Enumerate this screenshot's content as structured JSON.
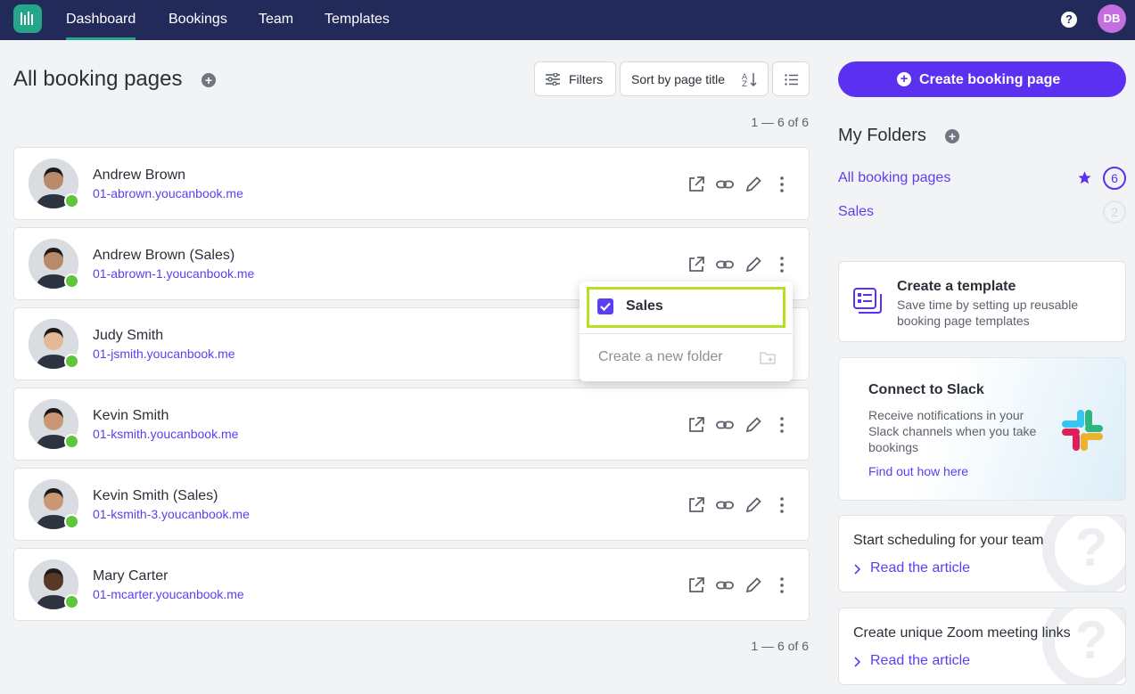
{
  "nav": {
    "items": [
      "Dashboard",
      "Bookings",
      "Team",
      "Templates"
    ],
    "active": "Dashboard",
    "help": "?",
    "user_initials": "DB"
  },
  "header": {
    "title": "All booking pages",
    "filters_label": "Filters",
    "sort_label": "Sort by page title",
    "count_top": "1 — 6 of 6",
    "count_bottom": "1 — 6 of 6"
  },
  "bookings": [
    {
      "name": "Andrew Brown",
      "link": "01-abrown.youcanbook.me",
      "status": "online"
    },
    {
      "name": "Andrew Brown (Sales)",
      "link": "01-abrown-1.youcanbook.me",
      "status": "online"
    },
    {
      "name": "Judy Smith",
      "link": "01-jsmith.youcanbook.me",
      "status": "online"
    },
    {
      "name": "Kevin Smith",
      "link": "01-ksmith.youcanbook.me",
      "status": "online"
    },
    {
      "name": "Kevin Smith (Sales)",
      "link": "01-ksmith-3.youcanbook.me",
      "status": "online"
    },
    {
      "name": "Mary Carter",
      "link": "01-mcarter.youcanbook.me",
      "status": "online"
    }
  ],
  "dropdown": {
    "folder": "Sales",
    "checked": true,
    "create_label": "Create a new folder"
  },
  "sidebar": {
    "create_button": "Create booking page",
    "folders_title": "My Folders",
    "folders": [
      {
        "label": "All booking pages",
        "count": "6",
        "starred": true
      },
      {
        "label": "Sales",
        "count": "2",
        "starred": false
      }
    ],
    "template_card": {
      "title": "Create a template",
      "text": "Save time by setting up reusable booking page templates"
    },
    "slack_card": {
      "title": "Connect to Slack",
      "text": "Receive notifications in your Slack channels when you take bookings",
      "link": "Find out how here"
    },
    "articles": [
      {
        "title": "Start scheduling for your team",
        "link": "Read the article"
      },
      {
        "title": "Create unique Zoom meeting links",
        "link": "Read the article"
      }
    ]
  },
  "colors": {
    "nav_bg": "#222a5a",
    "accent": "#5b30f0",
    "brand": "#25a58a",
    "highlight": "#b6e01e",
    "status_online": "#5fc53b"
  }
}
